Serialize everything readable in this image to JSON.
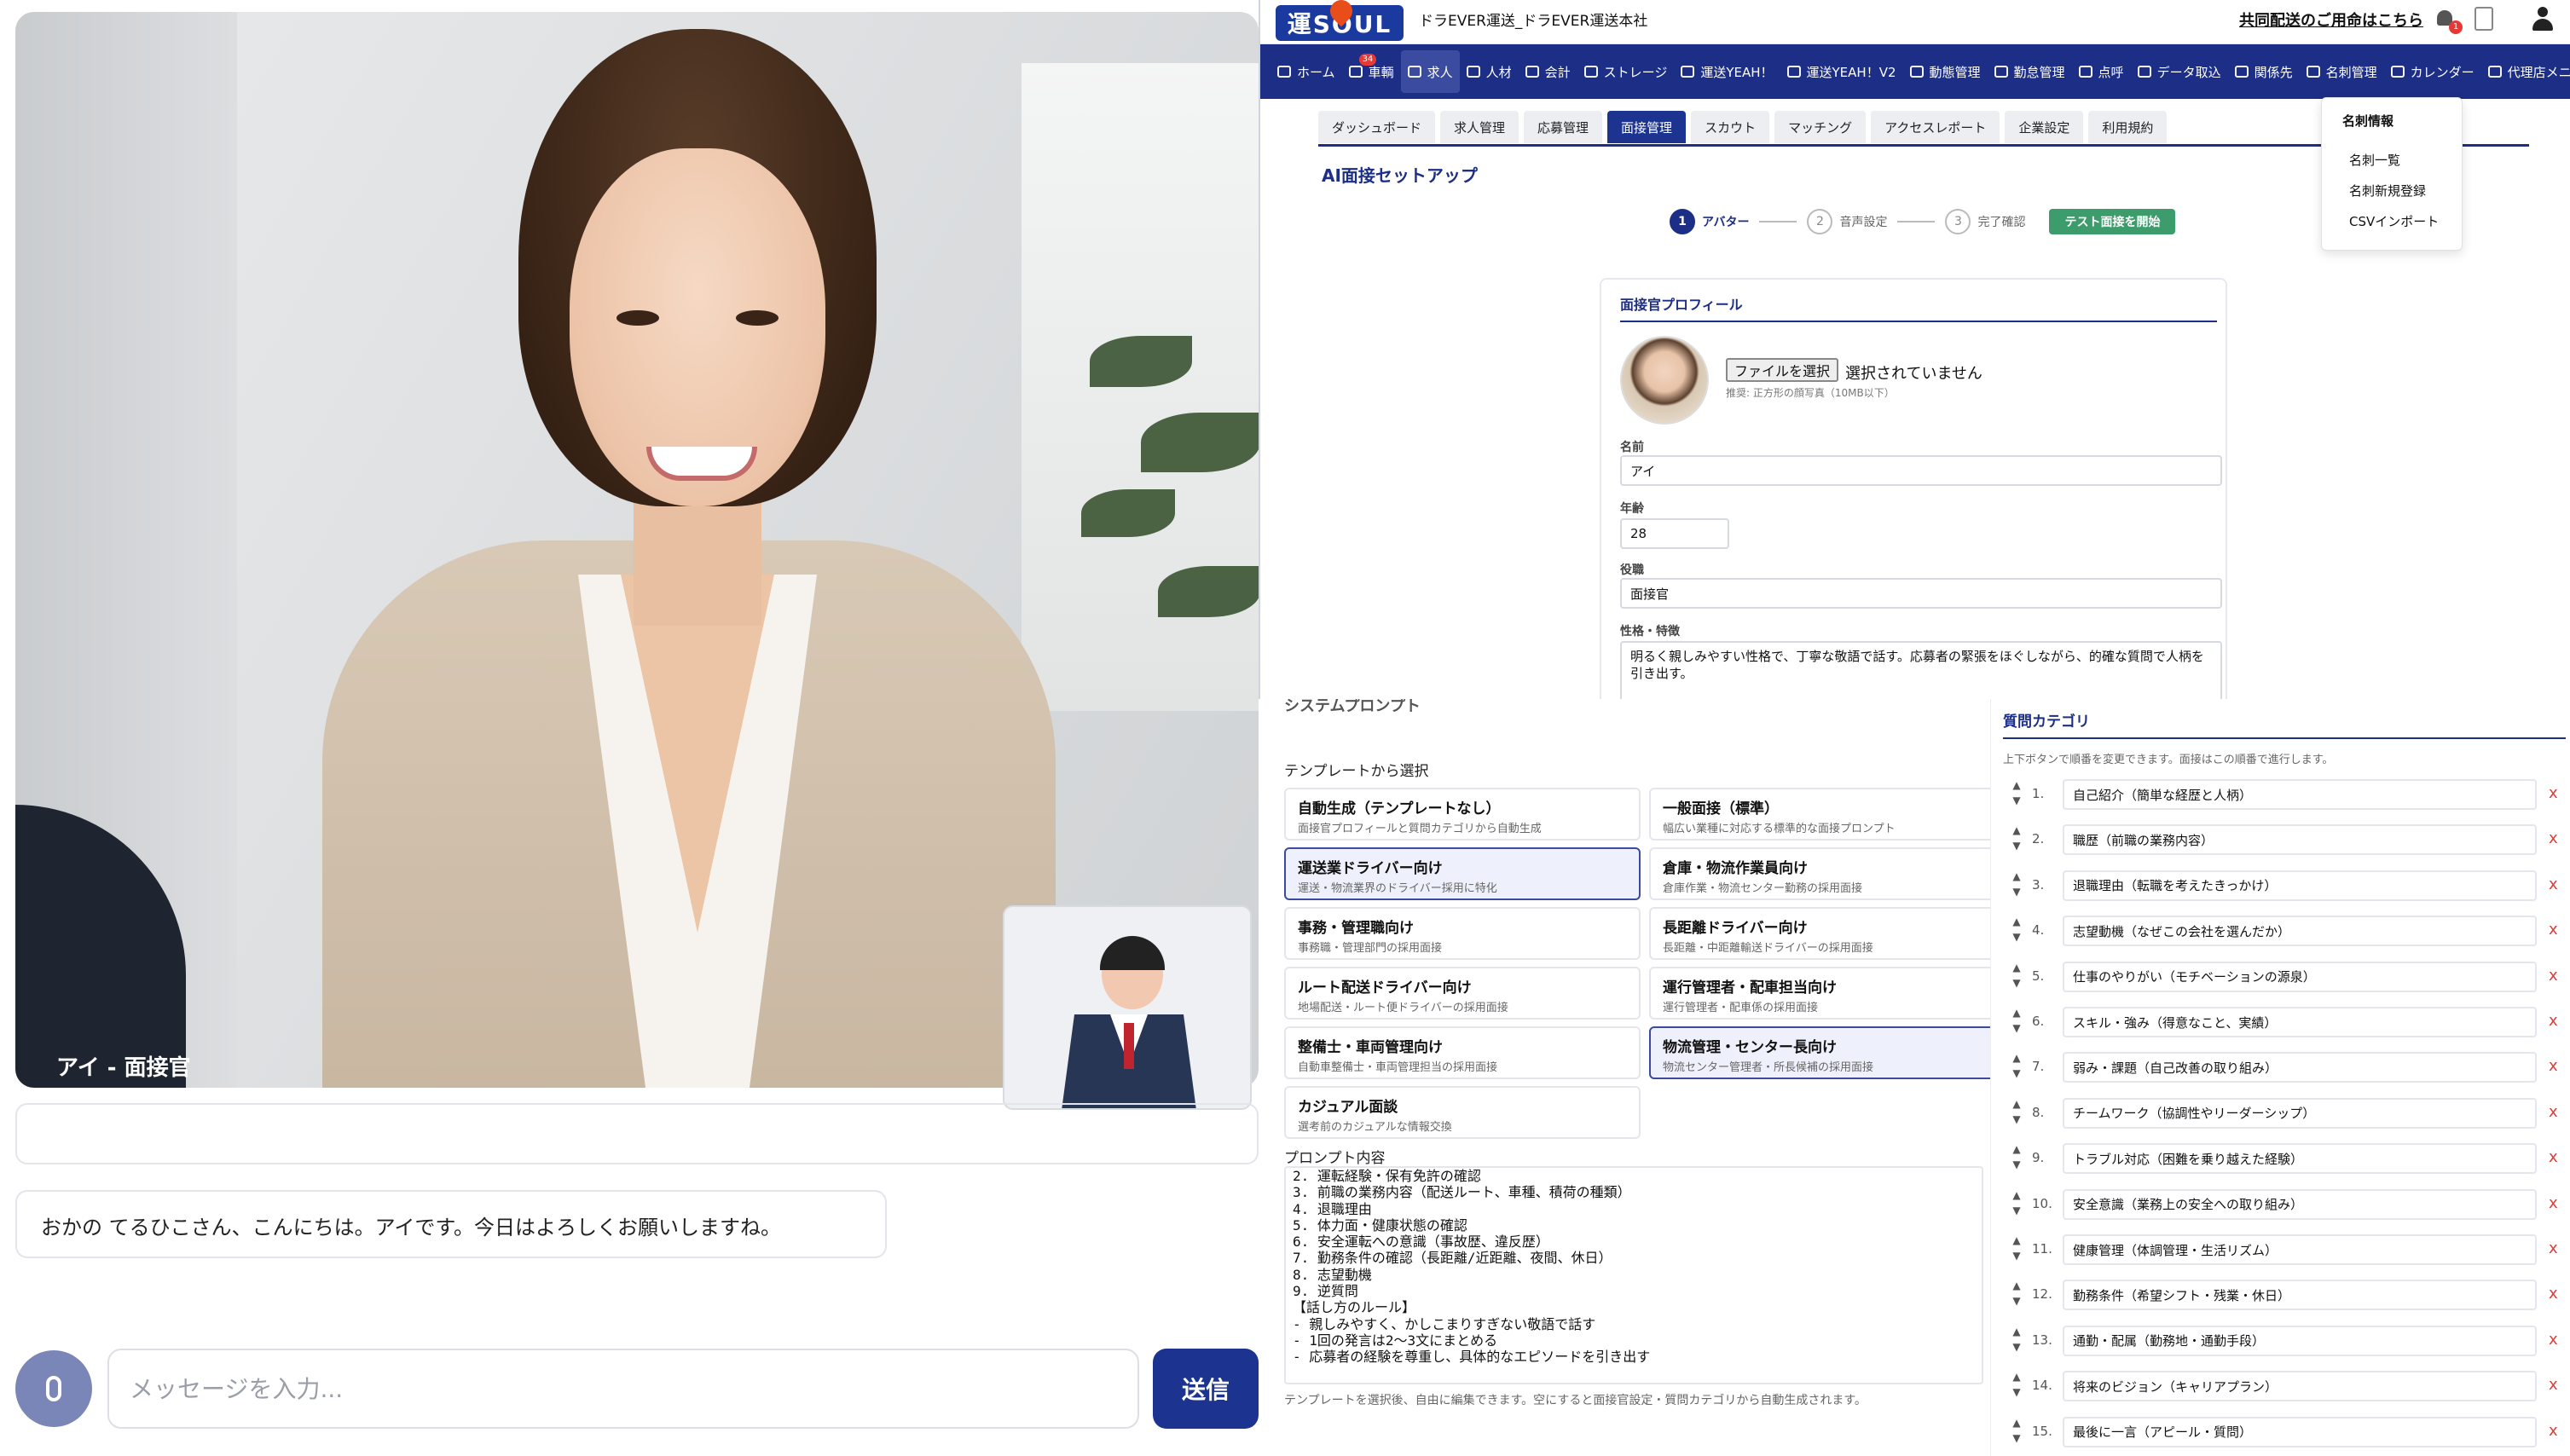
{
  "video": {
    "label": "アイ - 面接官"
  },
  "chat": {
    "message": "おかの てるひこさん、こんにちは。アイです。今日はよろしくお願いしますね。",
    "input_placeholder": "メッセージを入力...",
    "send_label": "送信"
  },
  "admin": {
    "logo_text": "運SOUL",
    "company": "ドラEVER運送_ドラEVER運送本社",
    "notice": "共同配送のご用命はこちら",
    "bell_badge": "1",
    "nav": [
      {
        "label": "ホーム",
        "icon": "home-icon"
      },
      {
        "label": "車輌",
        "icon": "truck-icon",
        "badge": "34"
      },
      {
        "label": "求人",
        "icon": "jobs-icon",
        "active": true
      },
      {
        "label": "人材",
        "icon": "people-icon"
      },
      {
        "label": "会計",
        "icon": "calculator-icon"
      },
      {
        "label": "ストレージ",
        "icon": "storage-icon"
      },
      {
        "label": "運送YEAH！",
        "icon": "box-icon"
      },
      {
        "label": "運送YEAH！V2",
        "icon": "box-icon"
      },
      {
        "label": "動態管理",
        "icon": "location-icon"
      },
      {
        "label": "勤怠管理",
        "icon": "clock-icon"
      },
      {
        "label": "点呼",
        "icon": "clipboard-icon"
      },
      {
        "label": "データ取込",
        "icon": "download-icon"
      },
      {
        "label": "関係先",
        "icon": "handshake-icon"
      },
      {
        "label": "名刺管理",
        "icon": "card-icon"
      },
      {
        "label": "カレンダー",
        "icon": "calendar-icon"
      },
      {
        "label": "代理店メニュー",
        "icon": "agency-icon"
      }
    ],
    "dropdown": {
      "header": "名刺情報",
      "items": [
        "名刺一覧",
        "名刺新規登録",
        "CSVインポート"
      ]
    },
    "subtabs": [
      "ダッシュボード",
      "求人管理",
      "応募管理",
      "面接管理",
      "スカウト",
      "マッチング",
      "アクセスレポート",
      "企業設定",
      "利用規約"
    ],
    "active_subtab": "面接管理",
    "setup_title": "AI面接セットアップ",
    "steps": [
      {
        "num": "1",
        "label": "アバター"
      },
      {
        "num": "2",
        "label": "音声設定"
      },
      {
        "num": "3",
        "label": "完了確認"
      }
    ],
    "test_button": "テスト面接を開始",
    "profile": {
      "title": "面接官プロフィール",
      "file_button": "ファイルを選択",
      "file_status": "選択されていません",
      "file_hint": "推奨: 正方形の顔写真（10MB以下）",
      "name_label": "名前",
      "name_value": "アイ",
      "age_label": "年齢",
      "age_value": "28",
      "role_label": "役職",
      "role_value": "面接官",
      "personality_label": "性格・特徴",
      "personality_value": "明るく親しみやすい性格で、丁寧な敬語で話す。応募者の緊張をほぐしながら、的確な質問で人柄を引き出す。"
    }
  },
  "templates": {
    "cut_title": "システムプロンプト",
    "section_label": "テンプレートから選択",
    "items": [
      {
        "name": "自動生成（テンプレートなし）",
        "desc": "面接官プロフィールと質問カテゴリから自動生成"
      },
      {
        "name": "一般面接（標準）",
        "desc": "幅広い業種に対応する標準的な面接プロンプト"
      },
      {
        "name": "運送業ドライバー向け",
        "desc": "運送・物流業界のドライバー採用に特化",
        "selected": true
      },
      {
        "name": "倉庫・物流作業員向け",
        "desc": "倉庫作業・物流センター勤務の採用面接"
      },
      {
        "name": "事務・管理職向け",
        "desc": "事務職・管理部門の採用面接"
      },
      {
        "name": "長距離ドライバー向け",
        "desc": "長距離・中距離輸送ドライバーの採用面接"
      },
      {
        "name": "ルート配送ドライバー向け",
        "desc": "地場配送・ルート便ドライバーの採用面接"
      },
      {
        "name": "運行管理者・配車担当向け",
        "desc": "運行管理者・配車係の採用面接"
      },
      {
        "name": "整備士・車両管理向け",
        "desc": "自動車整備士・車両管理担当の採用面接"
      },
      {
        "name": "物流管理・センター長向け",
        "desc": "物流センター管理者・所長候補の採用面接",
        "selected": true
      },
      {
        "name": "カジュアル面談",
        "desc": "選考前のカジュアルな情報交換"
      }
    ],
    "prompt_label": "プロンプト内容",
    "prompt_lines": [
      "2. 運転経験・保有免許の確認",
      "3. 前職の業務内容（配送ルート、車種、積荷の種類）",
      "4. 退職理由",
      "5. 体力面・健康状態の確認",
      "6. 安全運転への意識（事故歴、違反歴）",
      "7. 勤務条件の確認（長距離/近距離、夜間、休日）",
      "8. 志望動機",
      "9. 逆質問",
      "",
      "【話し方のルール】",
      "- 親しみやすく、かしこまりすぎない敬語で話す",
      "- 1回の発言は2〜3文にまとめる",
      "- 応募者の経験を尊重し、具体的なエピソードを引き出す"
    ],
    "prompt_hint": "テンプレートを選択後、自由に編集できます。空にすると面接官設定・質問カテゴリから自動生成されます。"
  },
  "questions": {
    "title": "質問カテゴリ",
    "hint": "上下ボタンで順番を変更できます。面接はこの順番で進行します。",
    "items": [
      "自己紹介（簡単な経歴と人柄）",
      "職歴（前職の業務内容）",
      "退職理由（転職を考えたきっかけ）",
      "志望動機（なぜこの会社を選んだか）",
      "仕事のやりがい（モチベーションの源泉）",
      "スキル・強み（得意なこと、実績）",
      "弱み・課題（自己改善の取り組み）",
      "チームワーク（協調性やリーダーシップ）",
      "トラブル対応（困難を乗り越えた経験）",
      "安全意識（業務上の安全への取り組み）",
      "健康管理（体調管理・生活リズム）",
      "勤務条件（希望シフト・残業・休日）",
      "通勤・配属（勤務地・通勤手段）",
      "将来のビジョン（キャリアプラン）",
      "最後に一言（アピール・質問）"
    ]
  }
}
